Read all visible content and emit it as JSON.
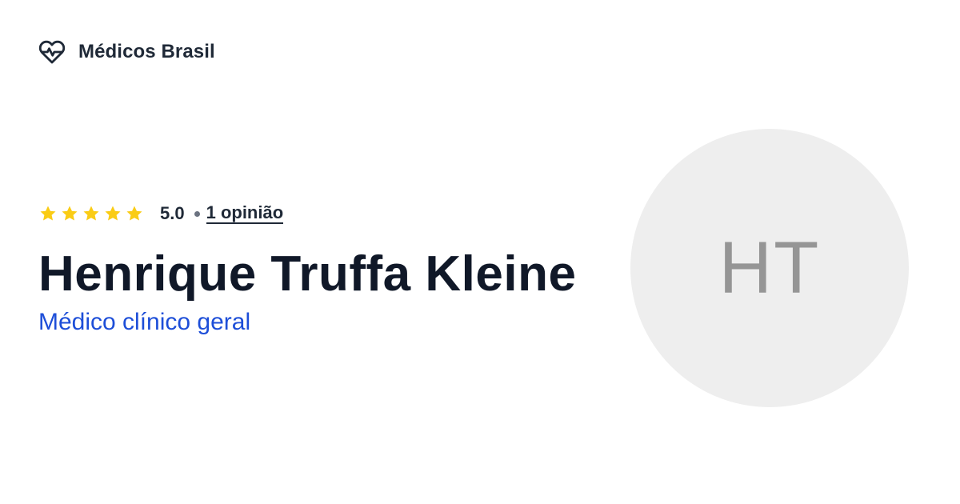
{
  "brand": {
    "name": "Médicos Brasil",
    "icon": "heart-pulse-icon"
  },
  "rating": {
    "stars_filled": 5,
    "stars_total": 5,
    "value": "5.0",
    "reviews_link": "1 opinião",
    "star_color": "#facc15"
  },
  "doctor": {
    "name": "Henrique Truffa Kleine",
    "specialty": "Médico clínico geral",
    "initials": "HT"
  },
  "colors": {
    "accent": "#1d4ed8",
    "avatar_bg": "#eeeeee"
  }
}
